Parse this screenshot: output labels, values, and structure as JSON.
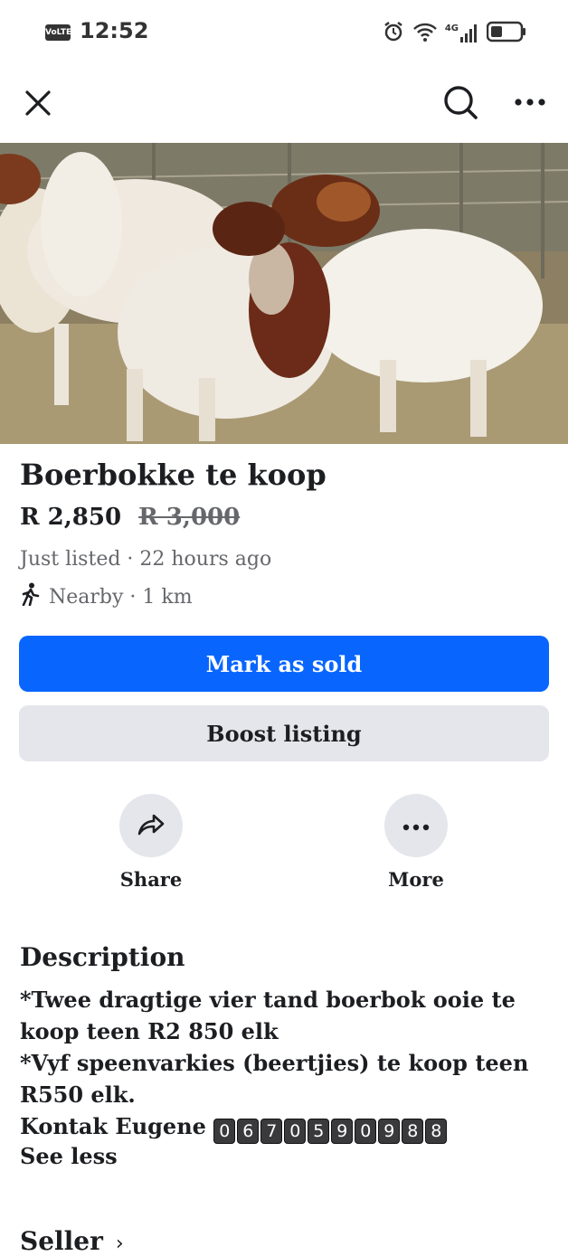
{
  "status_bar": {
    "volte": "VoLTE",
    "time": "12:52",
    "network": "4G",
    "icons": [
      "alarm-icon",
      "wifi-icon",
      "signal-icon",
      "battery-icon"
    ]
  },
  "top_bar": {
    "icons": [
      "close-icon",
      "search-icon",
      "more-icon"
    ]
  },
  "listing": {
    "title": "Boerbokke te koop",
    "price": "R 2,850",
    "old_price": "R 3,000",
    "listed": "Just listed · 22 hours ago",
    "nearby": "Nearby · 1 km"
  },
  "buttons": {
    "mark_sold": "Mark as sold",
    "boost": "Boost listing"
  },
  "actions": {
    "share": "Share",
    "more": "More"
  },
  "description": {
    "heading": "Description",
    "line1": "*Twee dragtige vier tand boerbok ooie te koop teen R2 850 elk",
    "line2": "*Vyf speenvarkies (beertjies) te koop teen R550 elk.",
    "contact_label": "Kontak Eugene",
    "phone_digits": [
      "0",
      "6",
      "7",
      "0",
      "5",
      "9",
      "0",
      "9",
      "8",
      "8"
    ],
    "see_less": "See less"
  },
  "seller": {
    "heading": "Seller",
    "chevron": "›"
  },
  "colors": {
    "primary": "#0866ff",
    "secondary_bg": "#e4e6eb",
    "muted_text": "#65676b"
  }
}
